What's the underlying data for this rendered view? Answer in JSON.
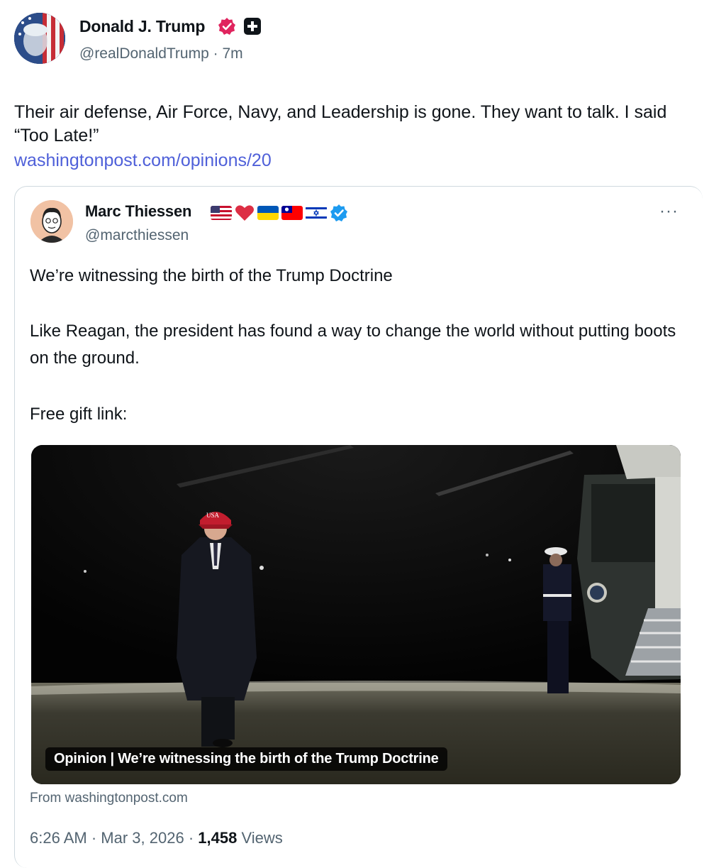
{
  "post": {
    "author_name": "Donald J. Trump",
    "handle": "@realDonaldTrump",
    "separator": "·",
    "time_ago": "7m",
    "text": "Their air defense, Air Force, Navy, and Leadership is gone. They want to talk. I said “Too Late!”",
    "link": "washingtonpost.com/opinions/20"
  },
  "quoted": {
    "author_name": "Marc Thiessen",
    "handle": "@marcthiessen",
    "more": "···",
    "paragraph_1": "We’re witnessing the birth of the Trump Doctrine",
    "paragraph_2": "Like Reagan, the president has found a way to change the world without putting boots on the ground.",
    "paragraph_3": "Free gift link:",
    "card": {
      "caption": "Opinion | We’re witnessing the birth of the Trump Doctrine",
      "hat_text": "USA",
      "source": "From washingtonpost.com"
    },
    "meta": {
      "time": "6:26 AM",
      "date": "Mar 3, 2026",
      "separator": "·",
      "views_count": "1,458",
      "views_label": "Views"
    }
  },
  "colors": {
    "link": "#4f60d9",
    "verified_pink": "#e0245e",
    "verified_blue": "#1d9bf0",
    "muted": "#536471"
  },
  "icons": [
    "verified-badge-icon",
    "plus-badge-icon",
    "more-options-icon",
    "verified-blue-icon",
    "us-flag-icon",
    "heart-icon",
    "ukraine-flag-icon",
    "taiwan-flag-icon",
    "israel-flag-icon"
  ]
}
